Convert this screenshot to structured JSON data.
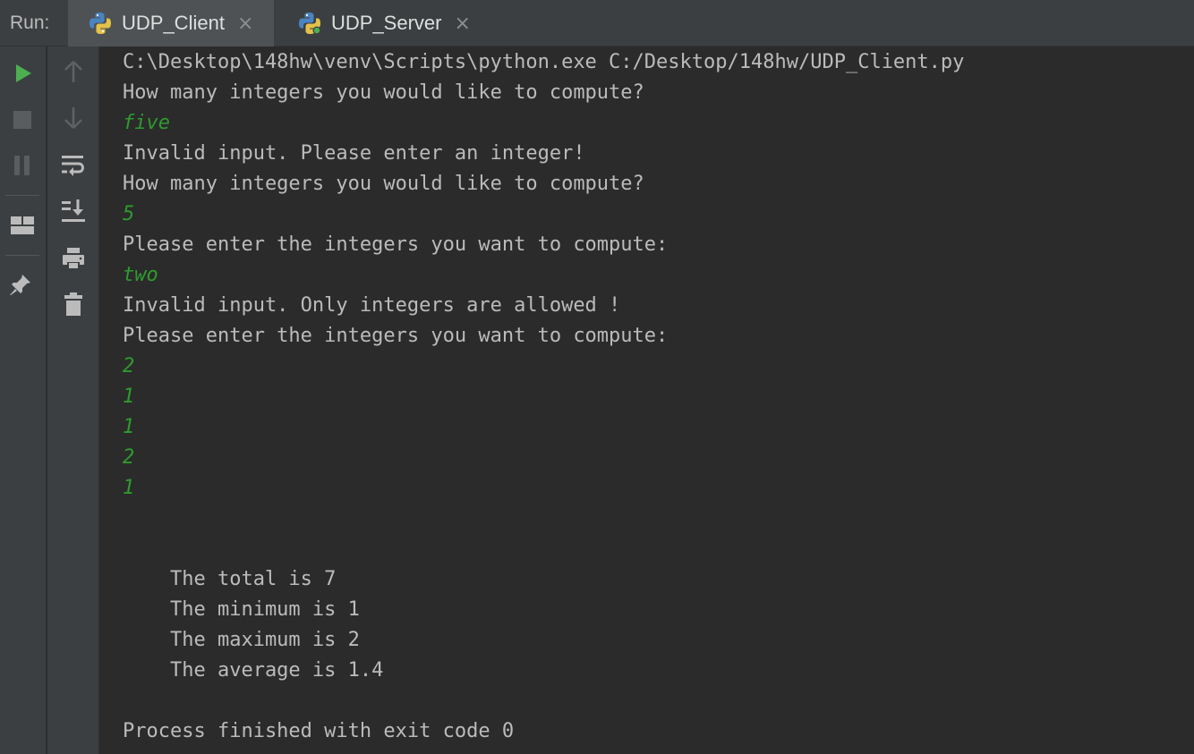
{
  "run_panel": {
    "label": "Run:",
    "tabs": [
      {
        "label": "UDP_Client",
        "active": true,
        "close": "×",
        "icon": "python-file-icon"
      },
      {
        "label": "UDP_Server",
        "active": false,
        "close": "×",
        "icon": "python-running-icon"
      }
    ]
  },
  "toolbar_left": [
    "run-icon",
    "stop-icon",
    "pause-icon",
    "layout-icon",
    "pin-icon"
  ],
  "toolbar_right": [
    "arrow-up-icon",
    "arrow-down-icon",
    "soft-wrap-icon",
    "scroll-to-end-icon",
    "print-icon",
    "trash-icon"
  ],
  "colors": {
    "console_text": "#bbbbbb",
    "user_input": "#2e9b2e",
    "run_green": "#4caf50",
    "background": "#2b2b2b"
  },
  "console": {
    "lines": [
      {
        "text": "C:\\Desktop\\148hw\\venv\\Scripts\\python.exe C:/Desktop/148hw/UDP_Client.py",
        "type": "output"
      },
      {
        "text": "How many integers you would like to compute?",
        "type": "output"
      },
      {
        "text": "five",
        "type": "input"
      },
      {
        "text": "Invalid input. Please enter an integer!",
        "type": "output"
      },
      {
        "text": "How many integers you would like to compute?",
        "type": "output"
      },
      {
        "text": "5",
        "type": "input"
      },
      {
        "text": "Please enter the integers you want to compute:",
        "type": "output"
      },
      {
        "text": "two",
        "type": "input"
      },
      {
        "text": "Invalid input. Only integers are allowed !",
        "type": "output"
      },
      {
        "text": "Please enter the integers you want to compute:",
        "type": "output"
      },
      {
        "text": "2",
        "type": "input"
      },
      {
        "text": "1",
        "type": "input"
      },
      {
        "text": "1",
        "type": "input"
      },
      {
        "text": "2",
        "type": "input"
      },
      {
        "text": "1",
        "type": "input"
      },
      {
        "text": "",
        "type": "output"
      },
      {
        "text": "",
        "type": "output"
      },
      {
        "text": "    The total is 7",
        "type": "output"
      },
      {
        "text": "    The minimum is 1",
        "type": "output"
      },
      {
        "text": "    The maximum is 2",
        "type": "output"
      },
      {
        "text": "    The average is 1.4",
        "type": "output"
      },
      {
        "text": "",
        "type": "output"
      },
      {
        "text": "Process finished with exit code 0",
        "type": "output"
      }
    ]
  }
}
